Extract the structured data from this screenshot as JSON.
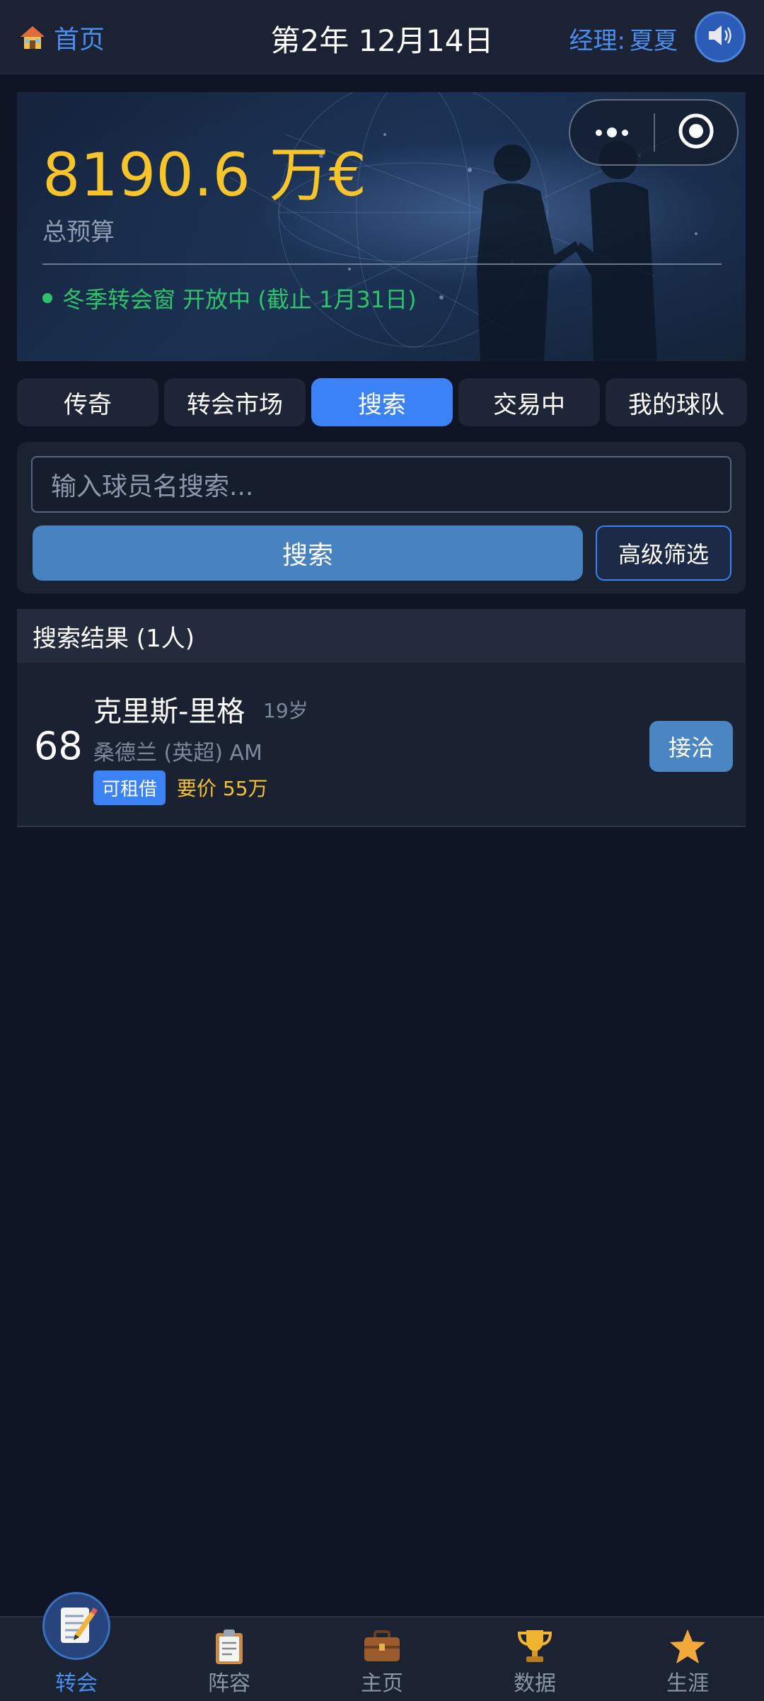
{
  "header": {
    "home_label": "首页",
    "date": "第2年 12月14日",
    "manager_label": "经理:",
    "manager_name": "夏夏"
  },
  "banner": {
    "budget": "8190.6 万€",
    "budget_label": "总预算",
    "window_status": "冬季转会窗 开放中 (截止 1月31日)"
  },
  "tabs": [
    {
      "label": "传奇",
      "active": false
    },
    {
      "label": "转会市场",
      "active": false
    },
    {
      "label": "搜索",
      "active": true
    },
    {
      "label": "交易中",
      "active": false
    },
    {
      "label": "我的球队",
      "active": false
    }
  ],
  "search": {
    "placeholder": "输入球员名搜索...",
    "button": "搜索",
    "filter_button": "高级筛选"
  },
  "results": {
    "header": "搜索结果 (1人)",
    "players": [
      {
        "rating": "68",
        "name": "克里斯-里格",
        "age": "19岁",
        "club": "桑德兰 (英超) AM",
        "badge": "可租借",
        "asking_price": "要价 55万",
        "action": "接洽"
      }
    ]
  },
  "bottom_nav": [
    {
      "label": "转会",
      "icon": "memo-icon",
      "active": true
    },
    {
      "label": "阵容",
      "icon": "clipboard-icon",
      "active": false
    },
    {
      "label": "主页",
      "icon": "briefcase-icon",
      "active": false
    },
    {
      "label": "数据",
      "icon": "trophy-icon",
      "active": false
    },
    {
      "label": "生涯",
      "icon": "star-icon",
      "active": false
    }
  ],
  "colors": {
    "accent": "#3b82f6",
    "budget": "#f7c52a",
    "status_open": "#2ec26a",
    "background": "#0f1524"
  }
}
